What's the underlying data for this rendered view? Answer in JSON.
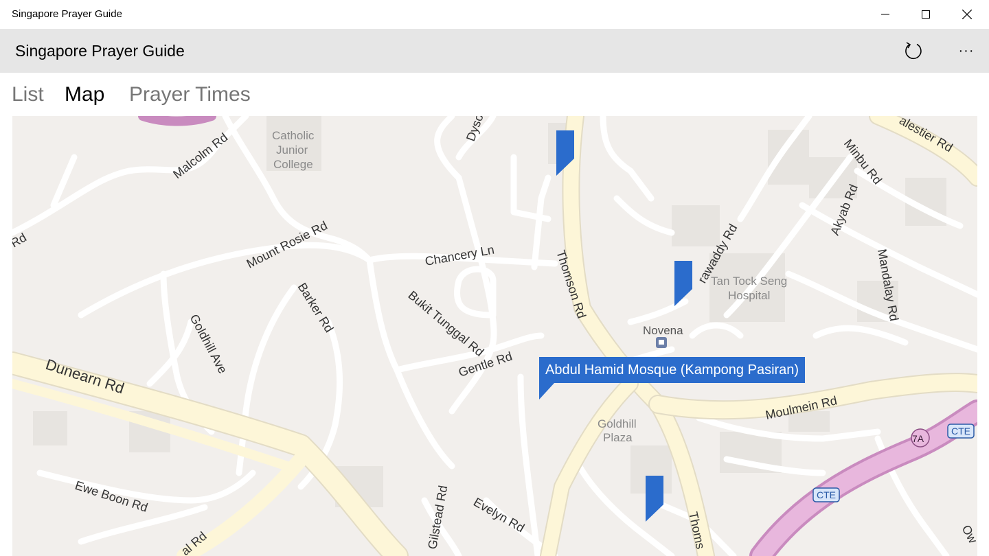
{
  "window": {
    "title": "Singapore Prayer Guide"
  },
  "appbar": {
    "title": "Singapore Prayer Guide",
    "refresh_icon": "refresh-icon",
    "more_icon": "more-icon",
    "more_label": "···"
  },
  "tabs": [
    {
      "label": "List",
      "active": false
    },
    {
      "label": "Map",
      "active": true
    },
    {
      "label": "Prayer Times",
      "active": false
    }
  ],
  "map": {
    "callout_text": "Abdul Hamid Mosque (Kampong Pasiran)",
    "accent_color": "#2b6ccc",
    "street_labels": {
      "malcolm": "Malcolm Rd",
      "dyson": "Dyso",
      "balestier": "alestier Rd",
      "minbu": "Minbu Rd",
      "akyab": "Akyab Rd",
      "irrawaddy": "rawaddy Rd",
      "mandalay": "Mandalay Rd",
      "rd_left": "Rd",
      "mount_rosie": "Mount Rosie Rd",
      "chancery": "Chancery Ln",
      "thomson": "Thomson Rd",
      "barker": "Barker Rd",
      "goldhill": "Goldhill Ave",
      "bukit_tunggal": "Bukit Tunggal Rd",
      "dunearn": "Dunearn Rd",
      "gentle": "Gentle Rd",
      "moulmein": "Moulmein Rd",
      "ewe_boon": "Ewe Boon Rd",
      "gilstead": "Gilstead Rd",
      "evelyn": "Evelyn Rd",
      "al_rd": "al Rd",
      "thoms": "Thoms",
      "ow": "Ow"
    },
    "places": {
      "catholic_1": "Catholic",
      "catholic_2": "Junior",
      "catholic_3": "College",
      "ttsh_1": "Tan Tock Seng",
      "ttsh_2": "Hospital",
      "novena": "Novena",
      "goldhill_1": "Goldhill",
      "goldhill_2": "Plaza"
    },
    "shields": {
      "exit": "7A",
      "cte_1": "CTE",
      "cte_2": "CTE"
    }
  }
}
